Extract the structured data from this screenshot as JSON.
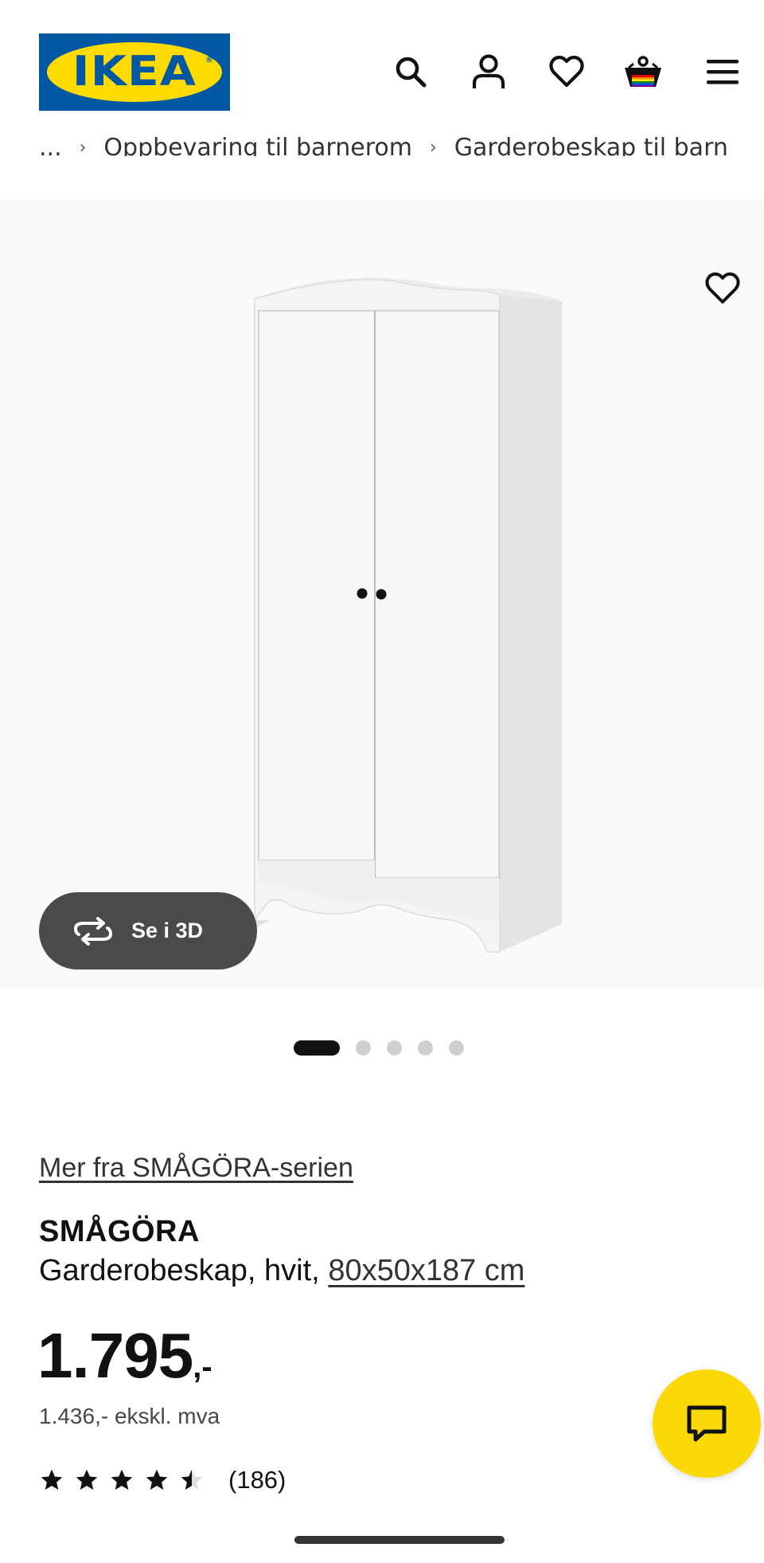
{
  "header": {
    "logo_text": "IKEA",
    "logo_reg": "®",
    "icons": [
      "search-icon",
      "account-icon",
      "heart-icon",
      "basket-icon",
      "menu-icon"
    ]
  },
  "breadcrumb": {
    "items": [
      "...",
      "Oppbevaring til barnerom",
      "Garderobeskap til barn"
    ],
    "separator": "›"
  },
  "gallery": {
    "view_3d_label": "Se i 3D",
    "image_count": 5,
    "active_index": 0
  },
  "product": {
    "series_link": "Mer fra SMÅGÖRA-serien",
    "name": "SMÅGÖRA",
    "desc_prefix": "Garderobeskap, hvit, ",
    "dimensions": "80x50x187 cm",
    "price_main": "1.795",
    "price_suffix": ",-",
    "price_ex_vat": "1.436,- ekskl. mva",
    "rating": 4.5,
    "reviews": "(186)"
  },
  "colors": {
    "brand_blue": "#0058a3",
    "brand_yellow": "#ffdb00",
    "chat_yellow": "#fad906"
  }
}
